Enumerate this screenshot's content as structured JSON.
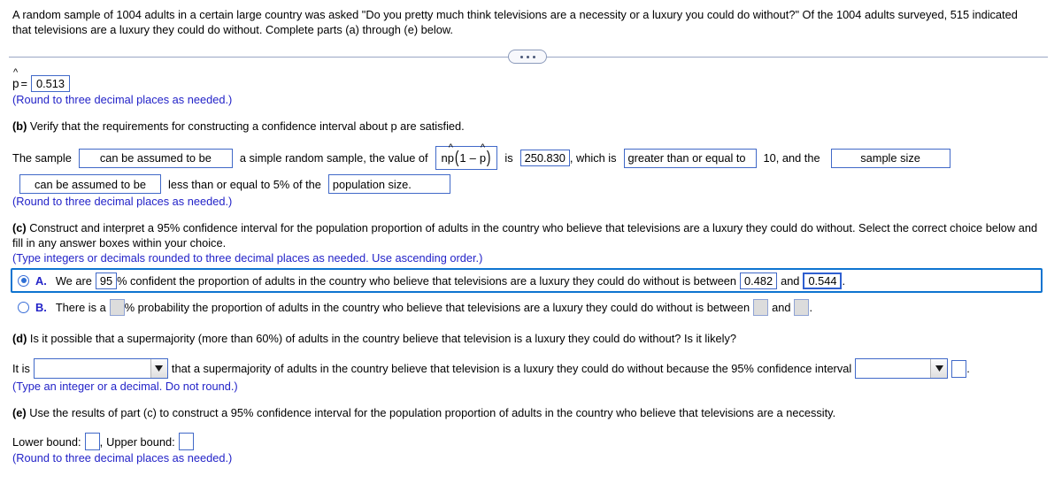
{
  "problem": {
    "intro": "A random sample of 1004 adults in a certain large country was asked \"Do you pretty much think televisions are a necessity or a luxury you could do without?\" Of the 1004 adults surveyed, 515 indicated that televisions are a luxury they could do without. Complete parts (a) through (e) below."
  },
  "divider": {
    "ellipsis_label": "more-options"
  },
  "part_a": {
    "phat_label": "p",
    "hat": "^",
    "equals": "=",
    "value": "0.513",
    "note": "(Round to three decimal places as needed.)"
  },
  "part_b": {
    "prompt_label": "(b)",
    "prompt_text": " Verify that the requirements for constructing a confidence interval about p are satisfied.",
    "s1": "The sample",
    "dropdown1": "can be assumed to be",
    "s2": "a simple random sample, the value of",
    "math": {
      "n": "n",
      "p": "p",
      "one": "1",
      "minus": "–"
    },
    "s3": "is",
    "value_np": "250.830",
    "s4": ", which is",
    "dropdown2": "greater than or equal to",
    "s5": "10, and the",
    "dropdown3": "sample size",
    "dropdown4": "can be assumed to be",
    "s6": "less than or equal to 5% of the",
    "dropdown5": "population size.",
    "note": "(Round to three decimal places as needed.)"
  },
  "part_c": {
    "prompt_label": "(c)",
    "prompt_text": " Construct and interpret a 95% confidence interval for the population proportion of adults in the country who believe that televisions are a luxury they could do without. Select the correct choice below and fill in any answer boxes within your choice.",
    "note": "(Type integers or decimals rounded to three decimal places as needed. Use ascending order.)",
    "choices": [
      {
        "letter": "A.",
        "selected": true,
        "text_before": "We are",
        "value1": "95",
        "text_mid": "% confident the proportion of adults in the country who believe that televisions are a luxury they could do without is between",
        "value2": "0.482",
        "and": "and",
        "value3": "0.544",
        "period": "."
      },
      {
        "letter": "B.",
        "selected": false,
        "text_before": "There is a",
        "value1": "",
        "text_mid": "% probability the proportion of adults in the country who believe that televisions are a luxury they could do without is between",
        "value2": "",
        "and": "and",
        "value3": "",
        "period": "."
      }
    ]
  },
  "part_d": {
    "prompt_label": "(d)",
    "prompt_text": " Is it possible that a supermajority (more than 60%) of adults in the country believe that television is a luxury they could do without? Is it likely?",
    "s1": "It is",
    "dropdown1": "",
    "s2": "that a supermajority of adults in the country believe that television is a luxury they could do without because the 95% confidence interval",
    "dropdown2": "",
    "box": "",
    "period": ".",
    "note": "(Type an integer or a decimal. Do not round.)"
  },
  "part_e": {
    "prompt_label": "(e)",
    "prompt_text": " Use the results of part (c) to construct a 95% confidence interval for the population proportion of adults in the country who believe that televisions are a necessity.",
    "lower_label": "Lower bound:",
    "lower_value": "",
    "comma": ",",
    "upper_label": "Upper bound:",
    "upper_value": "",
    "note": "(Round to three decimal places as needed.)"
  },
  "colors": {
    "instruction_blue": "#2323c8",
    "box_border_blue": "#4169c8",
    "selection_blue": "#0e74d0",
    "empty_box_gray": "#dcdcdc"
  }
}
